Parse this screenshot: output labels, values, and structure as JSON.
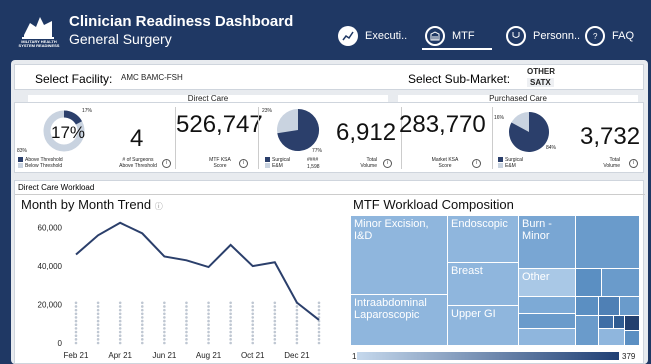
{
  "header": {
    "logo_text": "MILITARY HEALTH SYSTEM READINESS",
    "title": "Clinician Readiness Dashboard",
    "subtitle": "General Surgery",
    "nav": [
      {
        "label": "Executi..",
        "icon": "chart-icon"
      },
      {
        "label": "MTF",
        "icon": "building-icon"
      },
      {
        "label": "Personn..",
        "icon": "stethoscope-icon"
      },
      {
        "label": "FAQ",
        "icon": "question-icon"
      }
    ]
  },
  "filters": {
    "facility_label": "Select Facility:",
    "facility_value": "AMC BAMC-FSH",
    "submarket_label": "Select Sub-Market:",
    "submarket_value_1": "OTHER",
    "submarket_value_2": "SATX"
  },
  "sections": {
    "direct": "Direct Care",
    "purchased": "Purchased Care"
  },
  "kpis": {
    "threshold_pct": "17%",
    "threshold_top": "17%",
    "threshold_bottom": "83%",
    "above_label": "Above Threshold",
    "below_label": "Below Threshold",
    "surgeons_value": "4",
    "surgeons_label_1": "# of Surgeons",
    "surgeons_label_2": "Above Threshold",
    "mtf_ksa_value": "526,747",
    "mtf_ksa_label_1": "MTF KSA",
    "mtf_ksa_label_2": "Score",
    "dc_pie_top": "23%",
    "dc_pie_bottom": "77%",
    "dc_surgical_label": "Surgical",
    "dc_surgical_value": "####",
    "dc_em_label": "E&M",
    "dc_em_value": "1,598",
    "dc_total_value": "6,912",
    "dc_total_label_1": "Total",
    "dc_total_label_2": "Volume",
    "market_ksa_value": "283,770",
    "market_ksa_label_1": "Market KSA",
    "market_ksa_label_2": "Score",
    "pc_pie_top": "16%",
    "pc_pie_bottom": "84%",
    "pc_surgical_label": "Surgical",
    "pc_em_label": "E&M",
    "pc_total_value": "3,732",
    "pc_total_label_1": "Total",
    "pc_total_label_2": "Volume"
  },
  "workload": {
    "section_title": "Direct Care Workload",
    "trend_title": "Month by Month Trend",
    "composition_title": "MTF Workload Composition",
    "treemap": [
      "Minor Excision, I&D",
      "Endoscopic",
      "Burn - Minor",
      "Breast",
      "Other",
      "Intraabdominal Laparoscopic",
      "Upper GI"
    ],
    "scale_min": "1",
    "scale_max": "379"
  },
  "colors": {
    "navy": "#1f3864",
    "dark_blue": "#2b3f6b",
    "light_blue": "#c9d3e0",
    "treemap_light": "#8fb6dd",
    "treemap_mid": "#6a9bcb"
  },
  "chart_data": {
    "type": "line",
    "x": [
      "Feb 21",
      "Mar 21",
      "Apr 21",
      "May 21",
      "Jun 21",
      "Jul 21",
      "Aug 21",
      "Sep 21",
      "Oct 21",
      "Nov 21",
      "Dec 21",
      "Jan 22"
    ],
    "x_tick_labels": [
      "Feb 21",
      "Apr 21",
      "Jun 21",
      "Aug 21",
      "Oct 21",
      "Dec 21"
    ],
    "y_tick_labels": [
      "0",
      "20,000",
      "40,000",
      "60,000"
    ],
    "ylim": [
      0,
      65000
    ],
    "series": [
      {
        "values": [
          46000,
          56000,
          62500,
          57000,
          45000,
          43000,
          39500,
          51000,
          40000,
          42000,
          21000,
          12000
        ]
      }
    ]
  }
}
